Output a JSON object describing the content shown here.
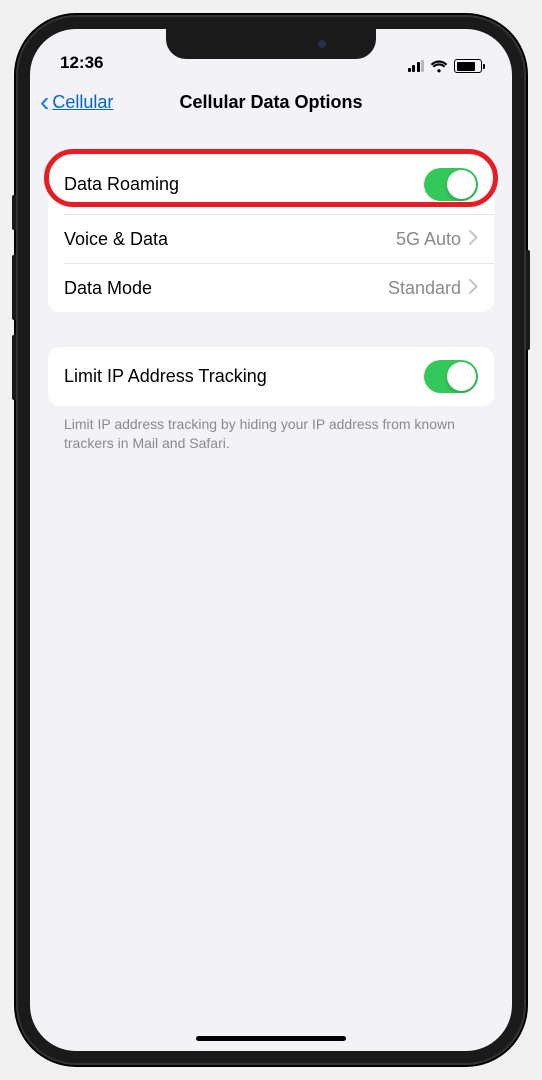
{
  "status": {
    "time": "12:36"
  },
  "nav": {
    "back_label": "Cellular",
    "title": "Cellular Data Options"
  },
  "group1": {
    "roaming": {
      "label": "Data Roaming",
      "on": true
    },
    "voice": {
      "label": "Voice & Data",
      "value": "5G Auto"
    },
    "mode": {
      "label": "Data Mode",
      "value": "Standard"
    }
  },
  "group2": {
    "limit": {
      "label": "Limit IP Address Tracking",
      "on": true
    },
    "footer": "Limit IP address tracking by hiding your IP address from known trackers in Mail and Safari."
  },
  "colors": {
    "accent": "#007aff",
    "toggle_on": "#34c759",
    "highlight": "#e81c24"
  }
}
